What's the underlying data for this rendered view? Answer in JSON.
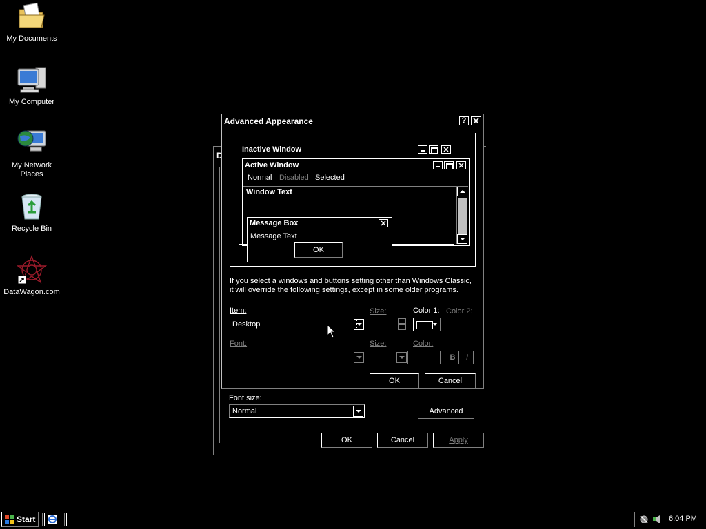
{
  "desktop": {
    "icons": [
      {
        "label": "My Documents",
        "icon": "folder-documents-icon"
      },
      {
        "label": "My Computer",
        "icon": "computer-icon"
      },
      {
        "label": "My Network Places",
        "icon": "network-places-icon"
      },
      {
        "label": "Recycle Bin",
        "icon": "recycle-bin-icon"
      },
      {
        "label": "DataWagon.com",
        "icon": "shortcut-icon"
      }
    ]
  },
  "background_window": {
    "title_letter": "D",
    "font_size_label": "Font size:",
    "font_size_value": "Normal",
    "advanced_label": "Advanced",
    "ok_label": "OK",
    "cancel_label": "Cancel",
    "apply_label": "Apply"
  },
  "dialog": {
    "title": "Advanced Appearance",
    "preview": {
      "inactive_title": "Inactive Window",
      "active_title": "Active Window",
      "menu_normal": "Normal",
      "menu_disabled": "Disabled",
      "menu_selected": "Selected",
      "window_text": "Window Text",
      "message_box_title": "Message Box",
      "message_text": "Message Text",
      "message_ok": "OK"
    },
    "info_text_1": "If you select a windows and buttons setting other than Windows Classic,",
    "info_text_2": "it will override the following settings, except in some older programs.",
    "item_label": "Item:",
    "item_value": "Desktop",
    "size_label": "Size:",
    "color1_label": "Color 1:",
    "color2_label": "Color 2:",
    "font_label": "Font:",
    "font_size_label": "Size:",
    "font_color_label": "Color:",
    "bold_label": "B",
    "italic_label": "I",
    "ok_label": "OK",
    "cancel_label": "Cancel"
  },
  "taskbar": {
    "start_label": "Start",
    "clock": "6:04 PM"
  },
  "colors": {
    "background": "#000000",
    "text": "#ffffff",
    "disabled": "#808080"
  }
}
